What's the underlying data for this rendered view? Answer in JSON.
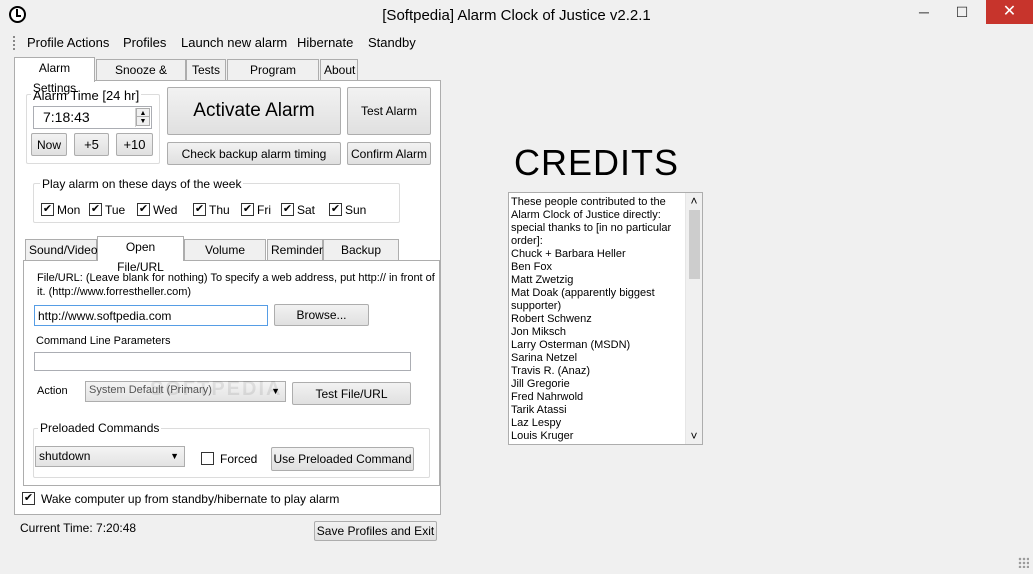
{
  "window": {
    "title": "[Softpedia] Alarm Clock of Justice v2.2.1",
    "minimize_glyph": "─",
    "maximize_glyph": "☐",
    "close_glyph": "✕"
  },
  "menu": [
    "Profile Actions",
    "Profiles",
    "Launch new alarm",
    "Hibernate",
    "Standby"
  ],
  "main_tabs": [
    "Alarm Settings",
    "Snooze & Timing",
    "Tests",
    "Program Settings",
    "About"
  ],
  "alarm_time": {
    "label": "Alarm Time [24 hr]",
    "value": "7:18:43",
    "now_label": "Now",
    "plus5_label": "+5",
    "plus10_label": "+10"
  },
  "actions": {
    "activate_label": "Activate Alarm",
    "test_label": "Test Alarm",
    "check_backup_label": "Check backup alarm timing",
    "confirm_label": "Confirm Alarm"
  },
  "days": {
    "label": "Play alarm on these days of the week",
    "items": [
      {
        "name": "Mon",
        "checked": "✔"
      },
      {
        "name": "Tue",
        "checked": "✔"
      },
      {
        "name": "Wed",
        "checked": "✔"
      },
      {
        "name": "Thu",
        "checked": "✔"
      },
      {
        "name": "Fri",
        "checked": "✔"
      },
      {
        "name": "Sat",
        "checked": "✔"
      },
      {
        "name": "Sun",
        "checked": "✔"
      }
    ]
  },
  "sub_tabs": [
    "Sound/Video",
    "Open File/URL",
    "Volume Effects",
    "Reminder",
    "Backup Alarm"
  ],
  "file_url": {
    "description": "File/URL: (Leave blank for nothing) To specify a web address, put http:// in front of it. (http://www.forrestheller.com)",
    "value": "http://www.softpedia.com",
    "browse_label": "Browse...",
    "cmd_label": "Command Line Parameters",
    "cmd_value": "",
    "action_label": "Action",
    "action_value": "System Default (Primary)",
    "test_label": "Test File/URL",
    "watermark": "SOFTPEDIA"
  },
  "preloaded": {
    "label": "Preloaded Commands",
    "value": "shutdown",
    "forced_label": "Forced",
    "use_label": "Use Preloaded Command"
  },
  "wake": {
    "label": "Wake computer up from standby/hibernate to play alarm",
    "checked": "✔"
  },
  "status": {
    "current_time": "Current Time: 7:20:48",
    "save_exit_label": "Save Profiles and Exit"
  },
  "credits": {
    "heading": "CREDITS",
    "lines": [
      "These people contributed to the",
      "Alarm Clock of Justice directly:",
      "special thanks to [in no particular",
      "order]:",
      "Chuck + Barbara Heller",
      "Ben Fox",
      "Matt Zwetzig",
      "Mat Doak (apparently biggest",
      "supporter)",
      "Robert Schwenz",
      "Jon Miksch",
      "Larry Osterman (MSDN)",
      "Sarina Netzel",
      "Travis R. (Anaz)",
      "Jill Gregorie",
      "Fred Nahrwold",
      "Tarik Atassi",
      "Laz Lespy",
      "Louis Kruger"
    ],
    "scroll_up_glyph": "˄",
    "scroll_down_glyph": "˅"
  }
}
